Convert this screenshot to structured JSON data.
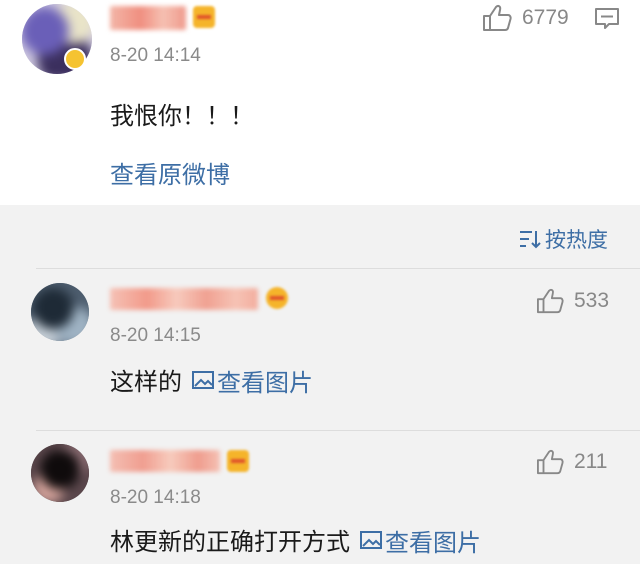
{
  "main_comment": {
    "time": "8-20 14:14",
    "likes": "6779",
    "text": "我恨你！！！",
    "view_original": "查看原微博"
  },
  "sort": {
    "label": "按热度"
  },
  "replies": [
    {
      "time": "8-20 14:15",
      "likes": "533",
      "text": "这样的",
      "pic_label": "查看图片"
    },
    {
      "time": "8-20 14:18",
      "likes": "211",
      "text": "林更新的正确打开方式",
      "pic_label": "查看图片"
    }
  ],
  "colors": {
    "link": "#3d6ea5",
    "secondary_text": "#888888",
    "reply_bg": "#f2f2f2"
  }
}
